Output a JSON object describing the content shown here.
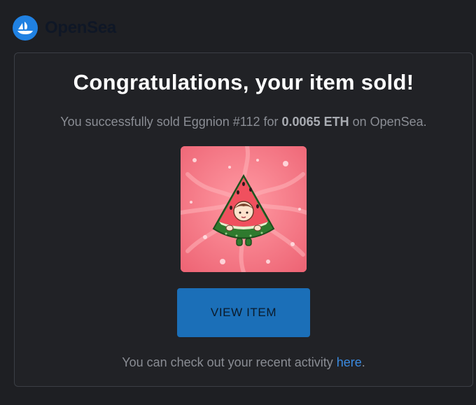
{
  "brand": {
    "name": "OpenSea",
    "icon": "opensea-boat-icon",
    "color": "#2081e2"
  },
  "card": {
    "title": "Congratulations, your item sold!",
    "desc_prefix": "You successfully sold ",
    "item_name": "Eggnion #112",
    "desc_mid": " for ",
    "price": "0.0065 ETH",
    "desc_suffix": " on OpenSea.",
    "image": "watermelon-character-nft",
    "button_label": "VIEW ITEM",
    "footer_prefix": "You can check out your recent activity ",
    "footer_link": "here",
    "footer_suffix": "."
  },
  "colors": {
    "accent": "#2081e2",
    "button": "#1b6fb8",
    "link": "#3a8ae0",
    "background": "#1e1f23"
  }
}
